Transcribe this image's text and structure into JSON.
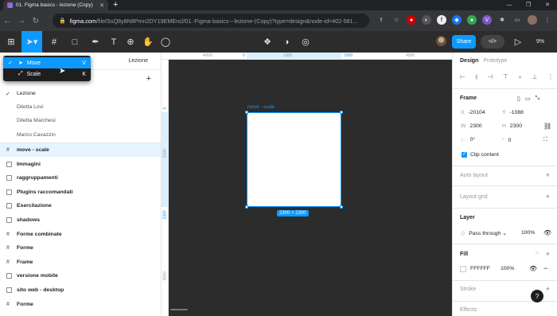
{
  "browser": {
    "tab_title": "01. Figma basics - lezione (Copy)",
    "url_host": "figma.com",
    "url_path": "/file/SsQ8y8N8Pmn2DY19EMEncl/01.-Figma-basics---lezione-(Copy)?type=design&node-id=402-581..."
  },
  "toolbar": {
    "share_label": "Share",
    "code_label": "</>",
    "zoom": "9%"
  },
  "tool_menu": {
    "items": [
      {
        "label": "Move",
        "shortcut": "V",
        "selected": true
      },
      {
        "label": "Scale",
        "shortcut": "K",
        "selected": false
      }
    ]
  },
  "left_panel": {
    "header_label": "Lezione",
    "pages": [
      "Lezione",
      "Diletta Lovi",
      "Diletta Marchesi",
      "Marco Cavazzin"
    ],
    "layers": [
      {
        "label": "move - scale",
        "icon": "frame-icon",
        "selected": true
      },
      {
        "label": "Immagini",
        "icon": "section-icon"
      },
      {
        "label": "raggruppamenti",
        "icon": "section-icon"
      },
      {
        "label": "Plugins raccomandati",
        "icon": "section-icon"
      },
      {
        "label": "Esercitazione",
        "icon": "section-icon"
      },
      {
        "label": "shadows",
        "icon": "section-icon"
      },
      {
        "label": "Forme combinate",
        "icon": "frame-icon"
      },
      {
        "label": "Forme",
        "icon": "frame-icon"
      },
      {
        "label": "Frame",
        "icon": "frame-icon"
      },
      {
        "label": "versione mobile",
        "icon": "section-icon"
      },
      {
        "label": "sito web - desktop",
        "icon": "section-icon"
      },
      {
        "label": "Forme",
        "icon": "frame-icon"
      }
    ]
  },
  "canvas": {
    "ruler_top": [
      "-4000",
      "0",
      "1000",
      "2300",
      "4000"
    ],
    "ruler_left": [
      "0",
      "1000",
      "2300",
      "4000"
    ],
    "frame_label": "move - scale",
    "size_badge": "2300 × 2300"
  },
  "right_panel": {
    "tab_design": "Design",
    "tab_prototype": "Prototype",
    "frame_title": "Frame",
    "x_label": "X",
    "x_value": "-20104",
    "y_label": "Y",
    "y_value": "-1088",
    "w_label": "W",
    "w_value": "2300",
    "h_label": "H",
    "h_value": "2300",
    "rotation": "0°",
    "radius": "0",
    "clip_content": "Clip content",
    "auto_layout": "Auto layout",
    "layout_grid": "Layout grid",
    "layer_title": "Layer",
    "blend_mode": "Pass through",
    "layer_opacity": "100%",
    "fill_title": "Fill",
    "fill_hex": "FFFFFF",
    "fill_opacity": "100%",
    "stroke_title": "Stroke",
    "effects_title": "Effects",
    "help": "?"
  },
  "colors": {
    "accent": "#0d99ff",
    "toolbar_bg": "#2c2c2c",
    "canvas_bg": "#2c2c2c",
    "frame_fill": "#FFFFFF"
  }
}
